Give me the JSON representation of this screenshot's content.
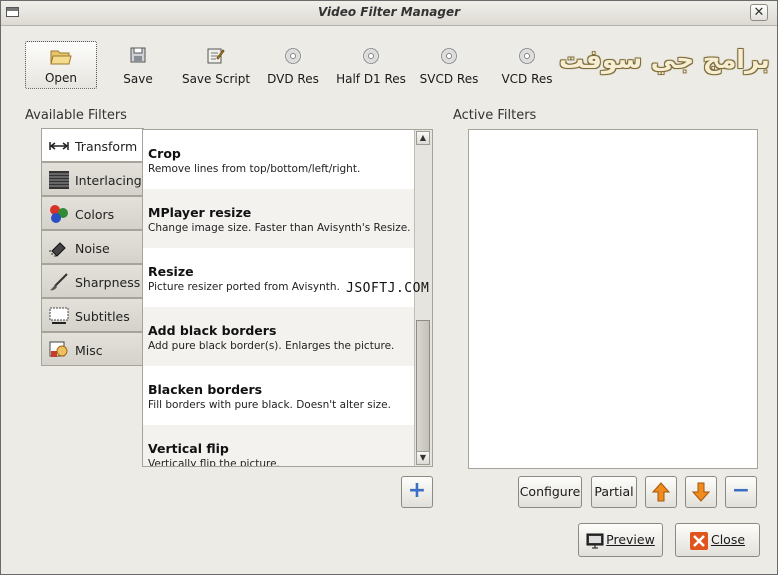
{
  "window": {
    "title": "Video Filter Manager",
    "close_glyph": "✕"
  },
  "toolbar": {
    "open": "Open",
    "save": "Save",
    "save_script": "Save Script",
    "dvd_res": "DVD Res",
    "half_d1_res": "Half D1 Res",
    "svcd_res": "SVCD Res",
    "vcd_res": "VCD Res"
  },
  "watermark": {
    "arabic": "برامج جي سوفت",
    "latin": "JSOFTJ.COM"
  },
  "available_filters_label": "Available Filters",
  "active_filters_label": "Active Filters",
  "tabs": [
    {
      "label": "Transform",
      "icon": "transform-arrows-icon"
    },
    {
      "label": "Interlacing",
      "icon": "interlacing-lines-icon"
    },
    {
      "label": "Colors",
      "icon": "colors-dots-icon"
    },
    {
      "label": "Noise",
      "icon": "noise-icon"
    },
    {
      "label": "Sharpness",
      "icon": "sharpness-brush-icon"
    },
    {
      "label": "Subtitles",
      "icon": "subtitles-icon"
    },
    {
      "label": "Misc",
      "icon": "misc-icon"
    }
  ],
  "filters": [
    {
      "name": "Crop",
      "desc": "Remove lines from top/bottom/left/right."
    },
    {
      "name": "MPlayer resize",
      "desc": "Change image size. Faster than Avisynth's Resize."
    },
    {
      "name": "Resize",
      "desc": "Picture resizer ported from Avisynth."
    },
    {
      "name": "Add black borders",
      "desc": "Add pure black border(s). Enlarges the picture."
    },
    {
      "name": "Blacken borders",
      "desc": "Fill borders with pure black. Doesn't alter size."
    },
    {
      "name": "Vertical flip",
      "desc": "Vertically flip the picture."
    }
  ],
  "buttons": {
    "configure": "Configure",
    "partial": "Partial",
    "preview": "Preview",
    "close": "Close",
    "add_glyph": "+",
    "remove_glyph": "−"
  },
  "colors": {
    "accent_blue": "#3a6fc4",
    "orange": "#f08c1e",
    "close_red": "#e0541e"
  }
}
